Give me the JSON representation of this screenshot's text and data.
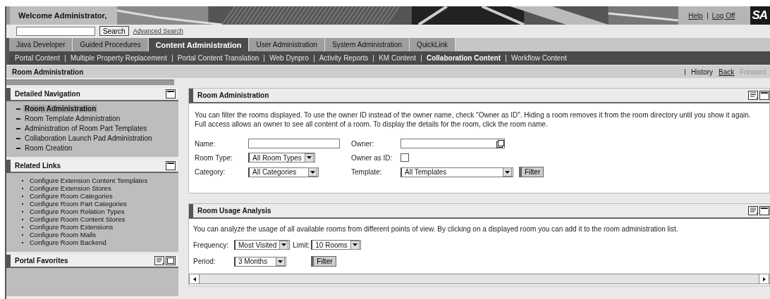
{
  "header": {
    "welcome": "Welcome Administrator,",
    "links": [
      "Help",
      "Log Off"
    ],
    "logo": "SA"
  },
  "search": {
    "button": "Search",
    "link": "Advanced Search"
  },
  "tabs": [
    {
      "label": "Java Developer",
      "selected": false
    },
    {
      "label": "Guided Procedures",
      "selected": false
    },
    {
      "label": "Content Administration",
      "selected": true
    },
    {
      "label": "User Administration",
      "selected": false
    },
    {
      "label": "System Administration",
      "selected": false
    },
    {
      "label": "QuickLink",
      "selected": false
    }
  ],
  "subnav": [
    {
      "label": "Portal Content",
      "selected": false
    },
    {
      "label": "Multiple Property Replacement",
      "selected": false
    },
    {
      "label": "Portal Content Translation",
      "selected": false
    },
    {
      "label": "Web Dynpro",
      "selected": false
    },
    {
      "label": "Activity Reports",
      "selected": false
    },
    {
      "label": "KM Content",
      "selected": false
    },
    {
      "label": "Collaboration Content",
      "selected": true
    },
    {
      "label": "Workflow Content",
      "selected": false
    }
  ],
  "page_title": "Room Administration",
  "history": [
    {
      "label": "History",
      "disabled": false
    },
    {
      "label": "Back",
      "disabled": false
    },
    {
      "label": "Forward",
      "disabled": true
    }
  ],
  "sidebar": {
    "detailed_navigation": {
      "title": "Detailed Navigation",
      "items": [
        {
          "label": "Room Administration",
          "selected": true
        },
        {
          "label": "Room Template Administration",
          "selected": false
        },
        {
          "label": "Administration of Room Part Templates",
          "selected": false
        },
        {
          "label": "Collaboration Launch Pad Administration",
          "selected": false
        },
        {
          "label": "Room Creation",
          "selected": false
        }
      ]
    },
    "related_links": {
      "title": "Related Links",
      "items": [
        "Configure Extension Content Templates",
        "Configure Extension Stores",
        "Configure Room Categories",
        "Configure Room Part Categories",
        "Configure Room Relation Types",
        "Configure Room Content Stores",
        "Configure Room Extensions",
        "Configure Room Mails",
        "Configure Room Backend"
      ]
    },
    "portal_favorites": {
      "title": "Portal Favorites"
    }
  },
  "room_administration": {
    "title": "Room Administration",
    "description": "You can filter the rooms displayed. To use the owner ID instead of the owner name, check \"Owner as ID\". Hiding a room removes it from the room directory until you show it again. Full access allows an owner to see all content of a room. To display the details for the room, click the room name.",
    "fields": [
      {
        "kind": "text",
        "label": "Name:"
      },
      {
        "kind": "lookup",
        "label": "Owner:"
      },
      {
        "kind": "select",
        "label": "Room Type:",
        "value": "All Room Types"
      },
      {
        "kind": "checkbox",
        "label": "Owner as ID:",
        "checked": false
      },
      {
        "kind": "select",
        "label": "Category:",
        "value": "All Categories"
      },
      {
        "kind": "select",
        "label": "Template:",
        "value": "All Templates"
      }
    ],
    "button": "Filter"
  },
  "room_usage_analysis": {
    "title": "Room Usage Analysis",
    "description": "You can analyze the usage of all available rooms from different points of view. By clicking on a displayed room you can add it to the room administration list.",
    "fields": [
      {
        "kind": "select",
        "label": "Frequency:",
        "value": "Most Visited"
      },
      {
        "kind": "select",
        "label": "Limit:",
        "value": "10 Rooms"
      },
      {
        "kind": "select",
        "label": "Period:",
        "value": "3 Months"
      }
    ],
    "button": "Filter"
  }
}
